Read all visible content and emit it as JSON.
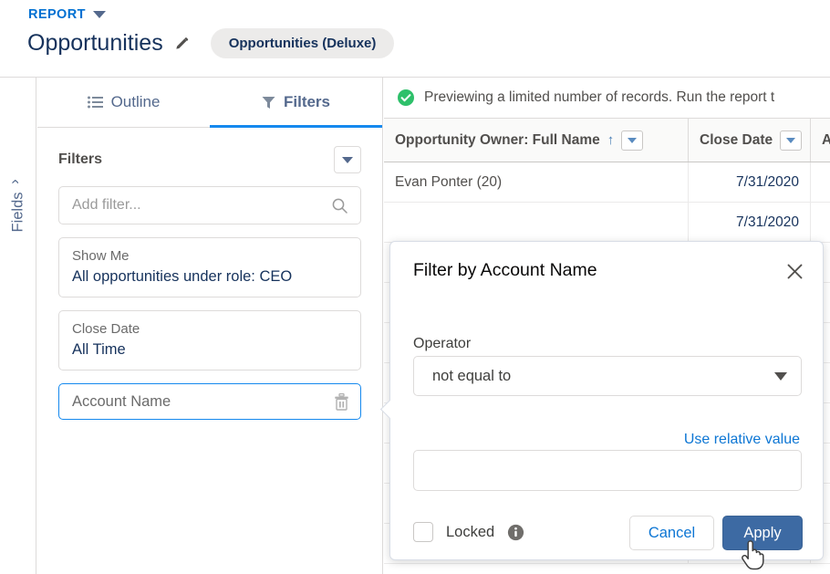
{
  "header": {
    "kicker": "REPORT",
    "kicker_icon": "caret-down-icon",
    "title": "Opportunities",
    "edit_icon": "pencil-icon",
    "report_type_pill": "Opportunities (Deluxe)"
  },
  "fields_rail": {
    "label": "Fields",
    "expand_icon": "chevron-right-icon"
  },
  "left_panel": {
    "tabs": [
      {
        "label": "Outline",
        "icon": "outline-list-icon",
        "active": false
      },
      {
        "label": "Filters",
        "icon": "funnel-icon",
        "active": true
      }
    ],
    "section_title": "Filters",
    "section_menu_icon": "caret-down-icon",
    "add_filter_placeholder": "Add filter...",
    "search_icon": "search-icon",
    "filters": [
      {
        "label": "Show Me",
        "value": "All opportunities under role: CEO",
        "selected": false
      },
      {
        "label": "Close Date",
        "value": "All Time",
        "selected": false
      },
      {
        "label": "Account Name",
        "value": "",
        "selected": true,
        "delete_icon": "trash-icon"
      }
    ]
  },
  "preview": {
    "banner": {
      "icon": "success-check-icon",
      "message": "Previewing a limited number of records. Run the report t"
    },
    "columns": [
      {
        "label": "Opportunity Owner: Full Name",
        "sort_icon": "sort-asc-arrow-icon",
        "menu_icon": "caret-down-icon"
      },
      {
        "label": "Close Date",
        "menu_icon": "caret-down-icon"
      },
      {
        "label": "A",
        "menu_icon": "caret-down-icon"
      }
    ],
    "rows": [
      {
        "owner": "Evan Ponter (20)",
        "close_date": "7/31/2020",
        "third": ""
      },
      {
        "owner": "",
        "close_date": "7/31/2020",
        "third": ""
      },
      {
        "owner": "",
        "close_date": "",
        "third": ""
      },
      {
        "owner": "",
        "close_date": "",
        "third": ""
      },
      {
        "owner": "",
        "close_date": "",
        "third": ""
      },
      {
        "owner": "",
        "close_date": "",
        "third": ""
      },
      {
        "owner": "",
        "close_date": "",
        "third": ""
      },
      {
        "owner": "",
        "close_date": "",
        "third": ""
      },
      {
        "owner": "",
        "close_date": "",
        "third": ""
      },
      {
        "owner": "",
        "close_date": "",
        "third": ""
      }
    ]
  },
  "popover": {
    "title": "Filter by Account Name",
    "close_icon": "close-icon",
    "operator_label": "Operator",
    "operator_value": "not equal to",
    "operator_caret_icon": "caret-down-icon",
    "relative_value_link": "Use relative value",
    "value_input": "",
    "value_placeholder": "",
    "locked_label": "Locked",
    "locked_checked": false,
    "info_icon": "info-icon",
    "cancel_label": "Cancel",
    "apply_label": "Apply"
  },
  "colors": {
    "link_blue": "#0070d2",
    "tab_underline": "#1589ee",
    "apply_button": "#3d6aa3",
    "title_navy": "#16325c",
    "success_green": "#4bca81",
    "border_gray": "#dddbda"
  }
}
